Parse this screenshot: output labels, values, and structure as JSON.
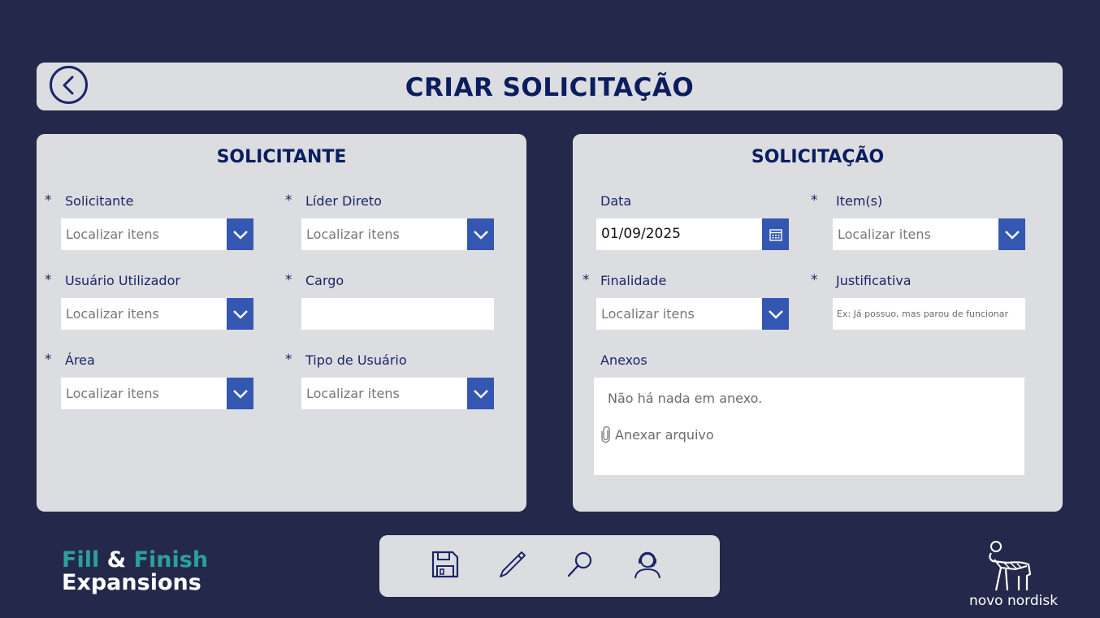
{
  "header": {
    "title": "CRIAR SOLICITAÇÃO"
  },
  "left_panel": {
    "title": "SOLICITANTE",
    "fields": {
      "solicitante": {
        "label": "Solicitante",
        "placeholder": "Localizar itens",
        "required": "*"
      },
      "lider_direto": {
        "label": "Líder Direto",
        "placeholder": "Localizar itens",
        "required": "*"
      },
      "usuario_utilizador": {
        "label": "Usuário Utilizador",
        "placeholder": "Localizar itens",
        "required": "*"
      },
      "cargo": {
        "label": "Cargo",
        "value": "",
        "required": "*"
      },
      "area": {
        "label": "Área",
        "placeholder": "Localizar itens",
        "required": "*"
      },
      "tipo_usuario": {
        "label": "Tipo de Usuário",
        "placeholder": "Localizar itens",
        "required": "*"
      }
    }
  },
  "right_panel": {
    "title": "SOLICITAÇÃO",
    "fields": {
      "data": {
        "label": "Data",
        "value": "01/09/2025"
      },
      "itens": {
        "label": "Item(s)",
        "placeholder": "Localizar itens",
        "required": "*"
      },
      "finalidade": {
        "label": "Finalidade",
        "placeholder": "Localizar itens",
        "required": "*"
      },
      "justificativa": {
        "label": "Justificativa",
        "placeholder": "Ex: Já possuo, mas parou de funcionar",
        "required": "*"
      },
      "anexos": {
        "label": "Anexos",
        "empty_text": "Não há nada em anexo.",
        "add_label": "Anexar arquivo"
      }
    }
  },
  "toolbar": {
    "icons": [
      "save-icon",
      "edit-icon",
      "search-icon",
      "support-agent-icon"
    ]
  },
  "branding": {
    "line1_a": "Fill",
    "line1_amp": "&",
    "line1_b": "Finish",
    "line2": "Expansions",
    "logo_text": "novo nordisk"
  },
  "colors": {
    "background": "#24284a",
    "panel": "#dcdde1",
    "accent": "#3457b2",
    "title": "#0b1d5f",
    "brand_teal": "#2aa198"
  }
}
